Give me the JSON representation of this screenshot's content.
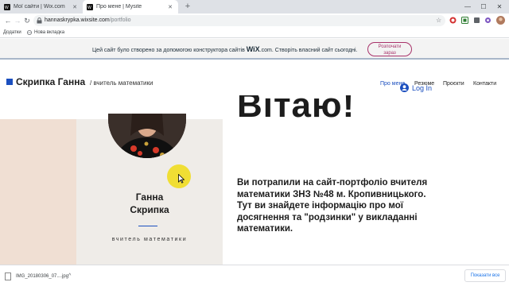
{
  "browser": {
    "tabs": [
      {
        "title": "Мої сайти | Wix.com",
        "close": "✕"
      },
      {
        "title": "Про мене | Mysite",
        "close": "✕"
      }
    ],
    "new_tab": "+",
    "window_controls": {
      "minimize": "—",
      "maximize": "☐",
      "close": "✕"
    },
    "nav": {
      "back": "←",
      "forward": "→",
      "reload": "↻"
    },
    "url": {
      "host": "hannaskrypka.wixsite.com",
      "path": "/portfolio"
    },
    "bookmark_star": "☆",
    "bookmarks": [
      {
        "label": "Додатки"
      },
      {
        "label": "Нова вкладка"
      }
    ]
  },
  "wix_banner": {
    "text_before": "Цей сайт було створено за допомогою конструктора сайтів ",
    "brand": "WiX",
    "text_after": ".com. Створіть власний сайт сьогодні.",
    "button_line1": "Розпочати",
    "button_line2": "зараз"
  },
  "site": {
    "name": "Скрипка Ганна",
    "subtitle": "/ вчитель математики",
    "menu": [
      "Про мене",
      "Резюме",
      "Проєкти",
      "Контакти"
    ],
    "login": "Log In",
    "heading": "Вітаю!",
    "card_name_line1": "Ганна",
    "card_name_line2": "Скрипка",
    "card_role": "вчитель математики",
    "intro": "Ви потрапили на сайт-портфоліо вчителя математики ЗНЗ №48 м. Кропивницького. Тут ви знайдете інформацію про мої досягнення та \"родзинки\" у викладанні математики."
  },
  "downloads": {
    "file_name": "IMG_20180306_07....jpg",
    "chevron": "^",
    "show_all": "Показати все",
    "close": "✕"
  },
  "colors": {
    "accent": "#1b4fbf",
    "banner_button": "#a8326a",
    "cursor_highlight": "#f0dc14"
  }
}
